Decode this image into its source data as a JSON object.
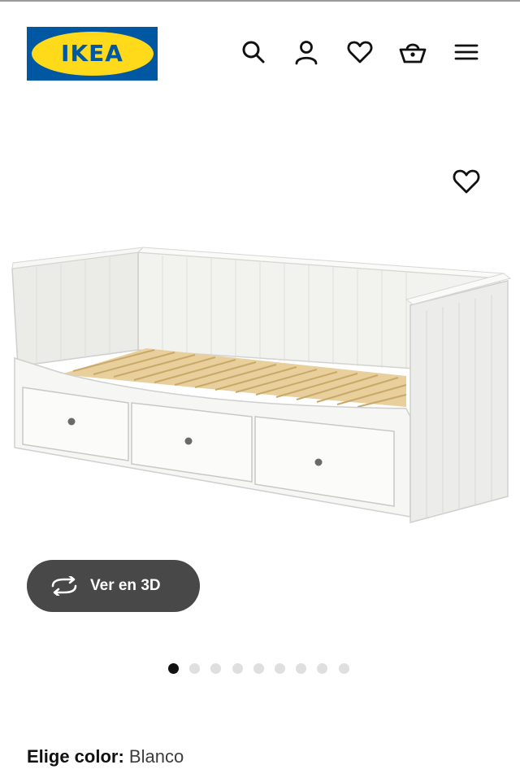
{
  "header": {
    "logo_text": "IKEA",
    "icons": [
      "search-icon",
      "user-icon",
      "heart-icon",
      "basket-icon",
      "menu-icon"
    ]
  },
  "product_image": {
    "favorite_icon": "heart-icon"
  },
  "view_3d": {
    "label": "Ver en 3D",
    "icon": "rotate-icon"
  },
  "carousel": {
    "total": 9,
    "active": 1
  },
  "color_selector": {
    "label": "Elige color:",
    "value": "Blanco"
  },
  "colors": {
    "ikea_blue": "#0058a3",
    "ikea_yellow": "#ffda1a",
    "button_dark": "#484848",
    "dot_active": "#111111",
    "dot_inactive": "#dfdfdf"
  }
}
